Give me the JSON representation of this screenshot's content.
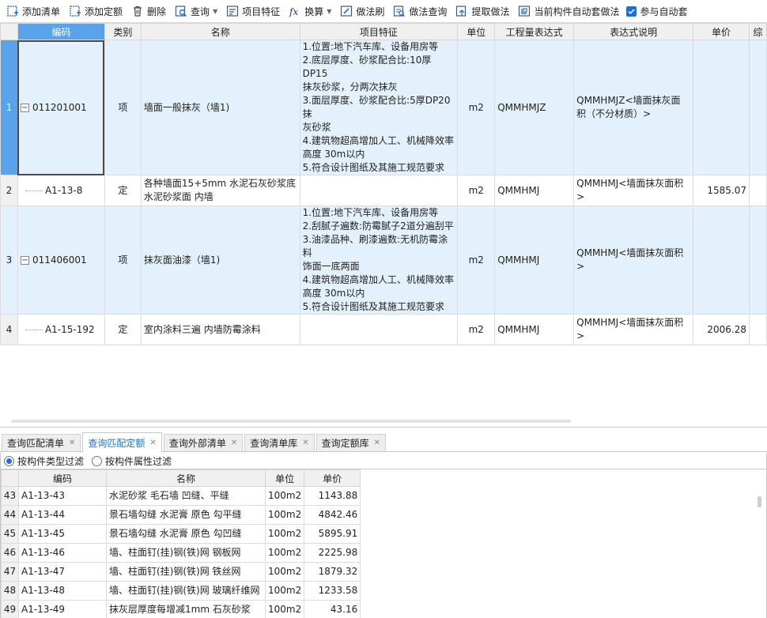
{
  "toolbar": {
    "items": [
      {
        "label": "添加清单",
        "icon": "add-list-icon"
      },
      {
        "label": "添加定额",
        "icon": "add-quota-icon"
      },
      {
        "label": "删除",
        "icon": "trash-icon"
      },
      {
        "label": "查询",
        "icon": "query-icon",
        "dropdown": true
      },
      {
        "label": "项目特征",
        "icon": "feature-icon"
      },
      {
        "label": "换算",
        "icon": "fx-icon",
        "dropdown": true
      },
      {
        "label": "做法刷",
        "icon": "brush-icon"
      },
      {
        "label": "做法查询",
        "icon": "method-query-icon"
      },
      {
        "label": "提取做法",
        "icon": "extract-icon"
      },
      {
        "label": "当前构件自动套做法",
        "icon": "auto-apply-icon"
      }
    ],
    "checkbox_label": "参与自动套",
    "checkbox_checked": true
  },
  "main_grid": {
    "columns": [
      "编码",
      "类别",
      "名称",
      "项目特征",
      "单位",
      "工程量表达式",
      "表达式说明",
      "单价",
      "综"
    ],
    "rows": [
      {
        "num": "1",
        "code": "011201001",
        "type": "项",
        "name": "墙面一般抹灰（墙1)",
        "feature": [
          "1.位置:地下汽车库、设备用房等",
          "2.底层厚度、砂浆配合比:10厚DP15",
          "抹灰砂浆，分两次抹灰",
          "3.面层厚度、砂浆配合比:5厚DP20抹",
          "灰砂浆",
          "4.建筑物超高增加人工、机械降效率",
          "高度 30m以内",
          "5.符合设计图纸及其施工规范要求"
        ],
        "unit": "m2",
        "expr": "QMMHMJZ",
        "expr_desc": [
          "QMMHMJZ<墙面抹灰面",
          "积（不分材质）>"
        ],
        "price": ""
      },
      {
        "num": "2",
        "code": "A1-13-8",
        "type": "定",
        "name": "各种墙面15+5mm 水泥石灰砂浆底水泥砂浆面 内墙",
        "feature": [],
        "unit": "m2",
        "expr": "QMMHMJ",
        "expr_desc": [
          "QMMHMJ<墙面抹灰面积",
          ">"
        ],
        "price": "1585.07"
      },
      {
        "num": "3",
        "code": "011406001",
        "type": "项",
        "name": "抹灰面油漆（墙1)",
        "feature": [
          "1.位置:地下汽车库、设备用房等",
          "2.刮腻子遍数:防霉腻子2道分遍刮平",
          "3.油漆品种、刷漆遍数:无机防霉涂料",
          "饰面一底两面",
          "4.建筑物超高增加人工、机械降效率",
          "高度 30m以内",
          "5.符合设计图纸及其施工规范要求"
        ],
        "unit": "m2",
        "expr": "QMMHMJ",
        "expr_desc": [
          "QMMHMJ<墙面抹灰面积",
          ">"
        ],
        "price": ""
      },
      {
        "num": "4",
        "code": "A1-15-192",
        "type": "定",
        "name": "室内涂料三遍 内墙防霉涂料",
        "feature": [],
        "unit": "m2",
        "expr": "QMMHMJ",
        "expr_desc": [
          "QMMHMJ<墙面抹灰面积",
          ">"
        ],
        "price": "2006.28"
      }
    ]
  },
  "tabs": [
    {
      "label": "查询匹配清单",
      "active": false
    },
    {
      "label": "查询匹配定额",
      "active": true
    },
    {
      "label": "查询外部清单",
      "active": false
    },
    {
      "label": "查询清单库",
      "active": false
    },
    {
      "label": "查询定额库",
      "active": false
    }
  ],
  "filters": {
    "by_type": "按构件类型过滤",
    "by_attr": "按构件属性过滤",
    "selected": "by_type"
  },
  "sub_grid": {
    "columns": [
      "编码",
      "名称",
      "单位",
      "单价"
    ],
    "rows": [
      {
        "num": "43",
        "code": "A1-13-43",
        "name": "水泥砂浆 毛石墙 凹缝、平缝",
        "unit": "100m2",
        "price": "1143.88"
      },
      {
        "num": "44",
        "code": "A1-13-44",
        "name": "景石墙勾缝 水泥膏 原色 勾平缝",
        "unit": "100m2",
        "price": "4842.46"
      },
      {
        "num": "45",
        "code": "A1-13-45",
        "name": "景石墙勾缝 水泥膏 原色 勾凹缝",
        "unit": "100m2",
        "price": "5895.91"
      },
      {
        "num": "46",
        "code": "A1-13-46",
        "name": "墙、柱面钉(挂)钢(铁)网 钢板网",
        "unit": "100m2",
        "price": "2225.98"
      },
      {
        "num": "47",
        "code": "A1-13-47",
        "name": "墙、柱面钉(挂)钢(铁)网 铁丝网",
        "unit": "100m2",
        "price": "1879.32"
      },
      {
        "num": "48",
        "code": "A1-13-48",
        "name": "墙、柱面钉(挂)钢(铁)网 玻璃纤维网",
        "unit": "100m2",
        "price": "1233.58"
      },
      {
        "num": "49",
        "code": "A1-13-49",
        "name": "抹灰层厚度每增减1mm 石灰砂浆",
        "unit": "100m2",
        "price": "43.16"
      }
    ]
  },
  "colors": {
    "accent": "#5aa3ea",
    "row_highlight": "#e3f1fc",
    "tab_active": "#1a73c8"
  }
}
